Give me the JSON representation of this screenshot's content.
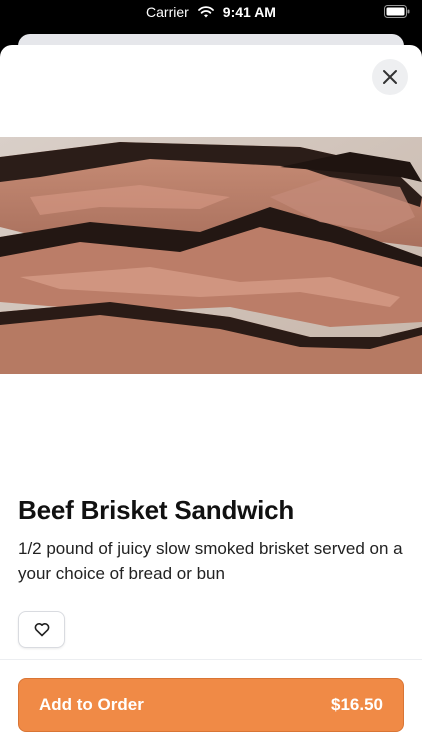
{
  "status_bar": {
    "carrier": "Carrier",
    "time": "9:41 AM"
  },
  "product": {
    "title": "Beef Brisket Sandwich",
    "description": "1/2 pound of juicy slow smoked brisket served on a your choice of bread or bun"
  },
  "actions": {
    "add_label": "Add to Order",
    "price": "$16.50"
  },
  "icons": {
    "close": "close-icon",
    "favorite": "heart-icon",
    "wifi": "wifi-icon",
    "battery": "battery-icon"
  },
  "colors": {
    "accent": "#f08a46"
  }
}
